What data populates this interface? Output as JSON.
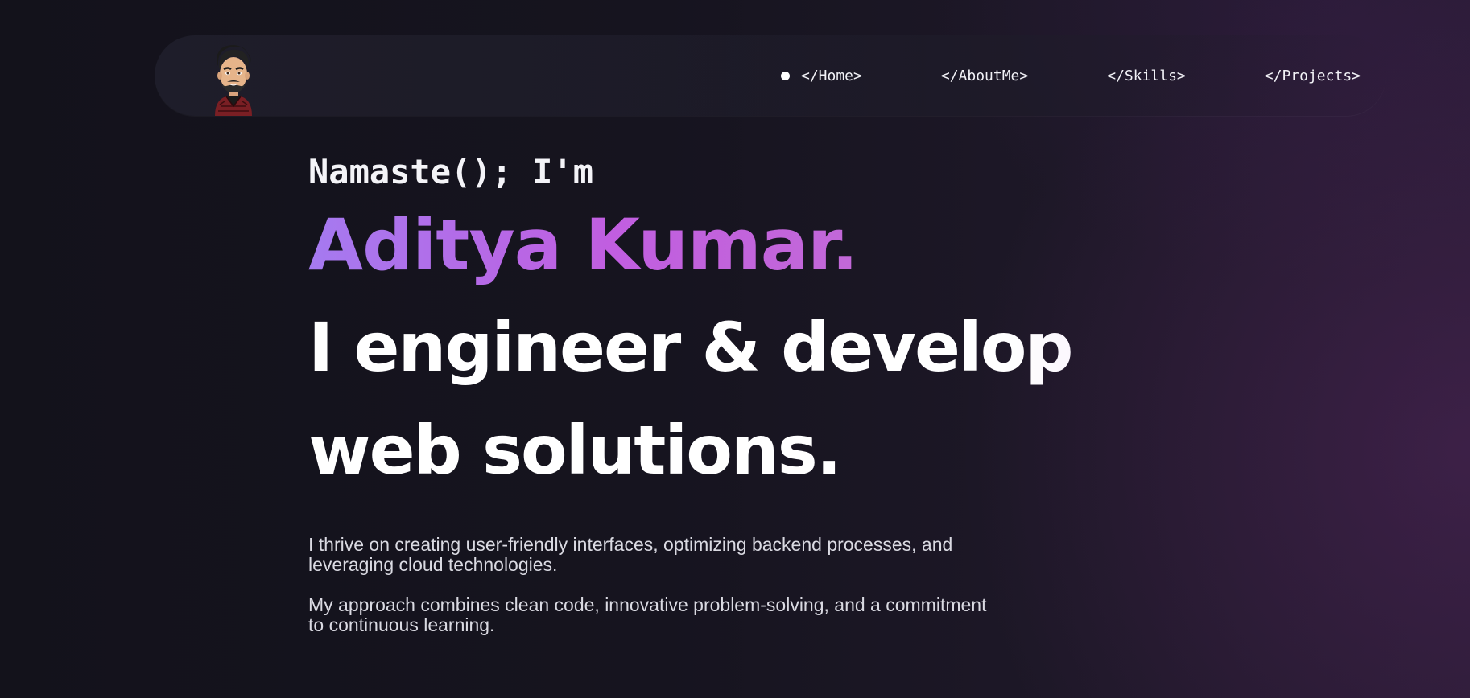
{
  "colors": {
    "background": "#15141f",
    "accent_start": "#a57af0",
    "accent_end": "#c15ee0",
    "text": "#ffffff",
    "muted_text": "#dadae2"
  },
  "navbar": {
    "avatar_icon": "bitmoji-avatar-icon",
    "active_indicator_icon": "dot-icon",
    "items": [
      {
        "label": "</Home>",
        "active": true
      },
      {
        "label": "</AboutMe>",
        "active": false
      },
      {
        "label": "</Skills>",
        "active": false
      },
      {
        "label": "</Projects>",
        "active": false
      }
    ]
  },
  "hero": {
    "greeting": "Namaste(); I'm",
    "name": "Aditya Kumar.",
    "tagline": "I engineer & develop web solutions.",
    "paragraphs": [
      "I thrive on creating user-friendly interfaces, optimizing backend processes, and leveraging cloud technologies.",
      "My approach combines clean code, innovative problem-solving, and a commitment to continuous learning."
    ]
  }
}
